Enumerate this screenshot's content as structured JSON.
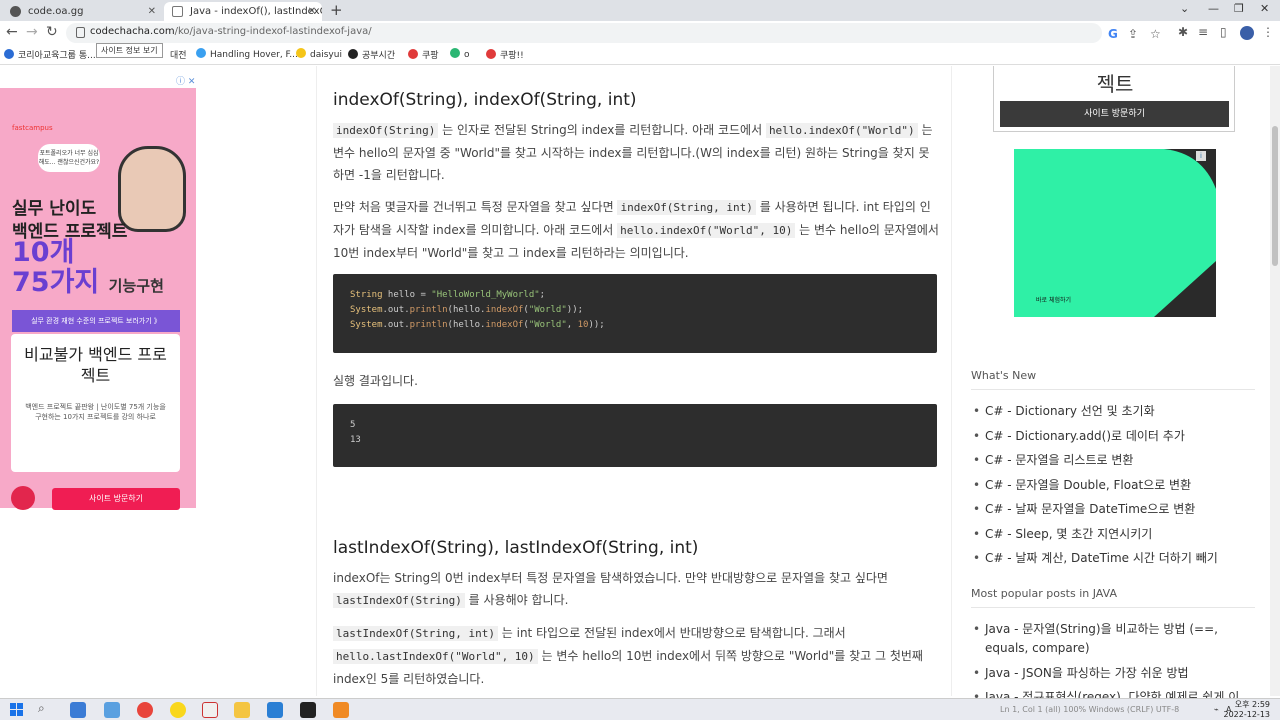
{
  "browser": {
    "tabs": [
      {
        "label": "code.oa.gg"
      },
      {
        "label": "Java - indexOf(), lastIndexOf()으"
      }
    ],
    "url_host": "codechacha.com",
    "url_path": "/ko/java-string-indexof-lastindexof-java/",
    "tooltip": "사이트 정보 보기",
    "bookmarks": [
      {
        "label": "코리아교육그룹 통...",
        "color": "#2b6cd4"
      },
      {
        "label": "대전",
        "color": "#f0a030"
      },
      {
        "label": "Handling Hover, F...",
        "color": "#3aa0f0"
      },
      {
        "label": "daisyui",
        "color": "#f5c518"
      },
      {
        "label": "공부시간",
        "color": "#222222"
      },
      {
        "label": "쿠팡",
        "color": "#e03a3a"
      },
      {
        "label": "o",
        "color": "#2bb673"
      },
      {
        "label": "쿠팡!!",
        "color": "#e03a3a"
      }
    ]
  },
  "ad_left": {
    "brand": "fastcampus",
    "bubble": "포트폴리오가 너무 심심해도... 괜찮으신건가요?",
    "headline1": "실무 난이도",
    "headline2": "백엔드 프로젝트",
    "big1": "10개",
    "big2": "75가지",
    "big2_sub": "기능구현",
    "strip": "실무 환경 재현 수준의 프로젝트 보러가기 》",
    "card_title": "비교불가 백엔드 프로젝트",
    "card_desc": "백엔드 프로젝트 끝판왕 | 난이도별 75개 기능을 구현하는 10가지 프로젝트를 강의 하나로",
    "button": "사이트 방문하기"
  },
  "article": {
    "h_indexof": "indexOf(String), indexOf(String, int)",
    "p1_code1": "indexOf(String)",
    "p1_text1": " 는 인자로 전달된 String의 index를 리턴합니다. 아래 코드에서 ",
    "p1_code2": "hello.indexOf(\"World\")",
    "p1_text2": " 는 변수 hello의 문자열 중 \"World\"를 찾고 시작하는 index를 리턴합니다.(W의 index를 리턴) 원하는 String을 찾지 못하면 -1을 리턴합니다.",
    "p2_text1": "만약 처음 몇글자를 건너뛰고 특정 문자열을 찾고 싶다면 ",
    "p2_code1": "indexOf(String, int)",
    "p2_text2": " 를 사용하면 됩니다. int 타입의 인자가 탐색을 시작할 index를 의미합니다. 아래 코드에서 ",
    "p2_code2": "hello.indexOf(\"World\", 10)",
    "p2_text3": " 는 변수 hello의 문자열에서 10번 index부터 \"World\"를 찾고 그 index를 리턴하라는 의미입니다.",
    "code1": {
      "kw_string": "String",
      "var": " hello = ",
      "str_init": "\"HelloWorld_MyWorld\"",
      "semi": ";",
      "sys": "System",
      "out": ".out.",
      "println": "println",
      "open": "(hello.",
      "indexOf": "indexOf",
      "arg_open": "(",
      "str_world": "\"World\"",
      "close1": "));",
      "comma": ", ",
      "num10": "10",
      "close2": "));"
    },
    "result_label": "실행 결과입니다.",
    "result_lines": [
      "5",
      "13"
    ],
    "h_lastindexof": "lastIndexOf(String), lastIndexOf(String, int)",
    "p3_text1": "indexOf는 String의 0번 index부터 특정 문자열을 탐색하였습니다. 만약 반대방향으로 문자열을 찾고 싶다면 ",
    "p3_code1": "lastIndexOf(String)",
    "p3_text2": " 를 사용해야 합니다.",
    "p4_code1": "lastIndexOf(String, int)",
    "p4_text1": " 는 int 타입으로 전달된 index에서 반대방향으로 탐색합니다. 그래서 ",
    "p4_code2": "hello.lastIndexOf(\"World\", 10)",
    "p4_text2": " 는 변수 hello의 10번 index에서 뒤쪽 방향으로 \"World\"를 찾고 그 첫번째 index인 5를 리턴하였습니다."
  },
  "sidebar": {
    "box_title": "젝트",
    "box_button": "사이트 방문하기",
    "ad_right_label": "바로 체험하기",
    "whats_new_title": "What's New",
    "whats_new": [
      "C# - Dictionary 선언 및 초기화",
      "C# - Dictionary.add()로 데이터 추가",
      "C# - 문자열을 리스트로 변환",
      "C# - 문자열을 Double, Float으로 변환",
      "C# - 날짜 문자열을 DateTime으로 변환",
      "C# - Sleep, 몇 초간 지연시키기",
      "C# - 날짜 계산, DateTime 시간 더하기 빼기"
    ],
    "popular_title": "Most popular posts in JAVA",
    "popular": [
      "Java - 문자열(String)을 비교하는 방법 (==, equals, compare)",
      "Java - JSON을 파싱하는 가장 쉬운 방법",
      "Java - 정규표현식(regex), 다양한 예제로 쉽게 이"
    ]
  },
  "taskbar": {
    "status": "Ln 1, Col 1 (all) 100% Windows (CRLF) UTF-8",
    "clock_line1": "오후 2:59",
    "clock_line2": "2022-12-13"
  },
  "colors": {
    "code_bg": "#2d2d2d",
    "ad_pink": "#f7a9c8",
    "ad_green": "#2ff0a6",
    "button_dark": "#3a3a3a"
  }
}
